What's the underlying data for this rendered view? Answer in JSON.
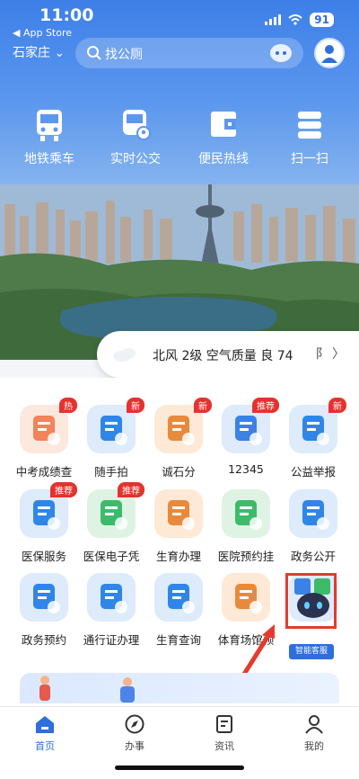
{
  "status_bar": {
    "time": "11:00",
    "back_app": "◀ App Store",
    "battery": "91"
  },
  "header": {
    "city": "石家庄",
    "search_placeholder": "找公厕"
  },
  "quick_actions": [
    {
      "label": "地铁乘车",
      "icon": "bus-icon"
    },
    {
      "label": "实时公交",
      "icon": "bus-location-icon"
    },
    {
      "label": "便民热线",
      "icon": "wallet-icon"
    },
    {
      "label": "扫一扫",
      "icon": "scan-icon"
    }
  ],
  "weather": {
    "text": "北风 2级 空气质量 良 74",
    "right_text": "阝 〉"
  },
  "services": [
    {
      "label": "中考成绩查",
      "badge": "热",
      "color": "#f4825a",
      "bg": "#fde8de"
    },
    {
      "label": "随手拍",
      "badge": "新",
      "color": "#2f86e8",
      "bg": "#ddebfb"
    },
    {
      "label": "诚石分",
      "badge": "新",
      "color": "#e88a3c",
      "bg": "#fde9d6"
    },
    {
      "label": "12345",
      "badge": "推荐",
      "color": "#3b82e6",
      "bg": "#dfeafb"
    },
    {
      "label": "公益举报",
      "badge": "新",
      "color": "#2f86e8",
      "bg": "#ddebfb"
    },
    {
      "label": "医保服务",
      "badge": "推荐",
      "color": "#2f86e8",
      "bg": "#ddebfb"
    },
    {
      "label": "医保电子凭",
      "badge": "推荐",
      "color": "#3dbb6a",
      "bg": "#def3e4"
    },
    {
      "label": "生育办理",
      "badge": "",
      "color": "#e88a3c",
      "bg": "#fde9d6"
    },
    {
      "label": "医院预约挂",
      "badge": "",
      "color": "#3dbb6a",
      "bg": "#def3e4"
    },
    {
      "label": "政务公开",
      "badge": "",
      "color": "#2f86e8",
      "bg": "#ddebfb"
    },
    {
      "label": "政务预约",
      "badge": "",
      "color": "#2f86e8",
      "bg": "#ddebfb"
    },
    {
      "label": "通行证办理",
      "badge": "",
      "color": "#2f86e8",
      "bg": "#ddebfb"
    },
    {
      "label": "生育查询",
      "badge": "",
      "color": "#2f86e8",
      "bg": "#ddebfb"
    },
    {
      "label": "体育场馆预",
      "badge": "",
      "color": "#e88a3c",
      "bg": "#fde9d6"
    },
    {
      "label": "",
      "badge": "",
      "color": "#3dbb6a",
      "bg": "#ddebfb"
    }
  ],
  "ai_label": "智能客服",
  "tabs": [
    {
      "label": "首页",
      "icon": "home-icon",
      "active": true
    },
    {
      "label": "办事",
      "icon": "compass-icon",
      "active": false
    },
    {
      "label": "资讯",
      "icon": "news-icon",
      "active": false
    },
    {
      "label": "我的",
      "icon": "user-icon",
      "active": false
    }
  ]
}
